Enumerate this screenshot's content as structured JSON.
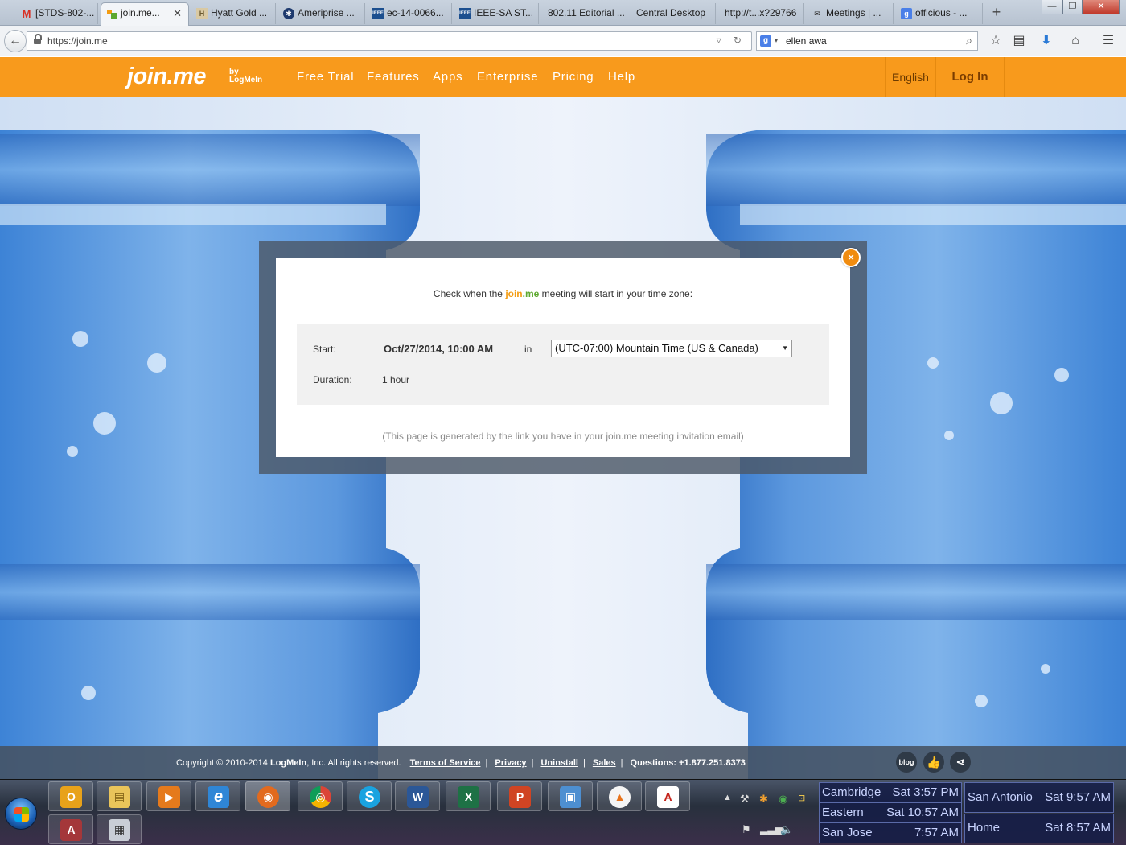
{
  "browser": {
    "tabs": [
      {
        "label": "[STDS-802-...",
        "icon": "gmail-icon"
      },
      {
        "label": "join.me...",
        "icon": "joinme-icon",
        "active": true
      },
      {
        "label": "Hyatt Gold ...",
        "icon": "page-icon"
      },
      {
        "label": "Ameriprise ...",
        "icon": "ameriprise-icon"
      },
      {
        "label": "ec-14-0066...",
        "icon": "ieee-icon"
      },
      {
        "label": "IEEE-SA ST...",
        "icon": "ieee-icon"
      },
      {
        "label": "802.11 Editorial ...",
        "icon": "blank-icon"
      },
      {
        "label": "Central Desktop",
        "icon": "blank-icon"
      },
      {
        "label": "http://t...x?29766",
        "icon": "blank-icon"
      },
      {
        "label": "Meetings | ...",
        "icon": "meetings-icon"
      },
      {
        "label": "officious - ...",
        "icon": "google-icon"
      }
    ],
    "url": "https://join.me",
    "search_engine_icon": "google-icon",
    "search_text": "ellen awa"
  },
  "site": {
    "logo_text": "join.me",
    "logo_by": "by",
    "logo_brand": "LogMeIn",
    "nav": [
      "Free Trial",
      "Features",
      "Apps",
      "Enterprise",
      "Pricing",
      "Help"
    ],
    "language": "English",
    "login": "Log In"
  },
  "modal": {
    "prompt_before": "Check when the ",
    "prompt_brand_join": "join",
    "prompt_brand_me": ".me",
    "prompt_after": " meeting will start in your time zone:",
    "start_label": "Start:",
    "start_value": "Oct/27/2014, 10:00 AM",
    "in_word": "in",
    "timezone": "(UTC-07:00) Mountain Time (US & Canada)",
    "duration_label": "Duration:",
    "duration_value": "1 hour",
    "footnote": "(This page is generated by the link you have in your join.me meeting invitation email)",
    "close_symbol": "×"
  },
  "footer": {
    "copyright_prefix": "Copyright © 2010-2014 ",
    "company": "LogMeIn",
    "copyright_suffix": ", Inc. All rights reserved.",
    "links": [
      "Terms of Service",
      "Privacy",
      "Uninstall",
      "Sales"
    ],
    "questions": "Questions: +1.877.251.8373",
    "blog_label": "blog"
  },
  "taskbar": {
    "pinned": [
      {
        "name": "outlook",
        "glyph": "O"
      },
      {
        "name": "explorer",
        "glyph": "▤"
      },
      {
        "name": "media-player",
        "glyph": "▶"
      },
      {
        "name": "internet-explorer",
        "glyph": "e"
      },
      {
        "name": "firefox",
        "glyph": "◉"
      },
      {
        "name": "chrome",
        "glyph": "◎"
      },
      {
        "name": "skype",
        "glyph": "S"
      },
      {
        "name": "word",
        "glyph": "W"
      },
      {
        "name": "excel",
        "glyph": "X"
      },
      {
        "name": "powerpoint",
        "glyph": "P"
      },
      {
        "name": "remote-desktop",
        "glyph": "▣"
      },
      {
        "name": "vlc",
        "glyph": "▲"
      },
      {
        "name": "acrobat",
        "glyph": "A"
      },
      {
        "name": "access",
        "glyph": "A"
      },
      {
        "name": "calculator",
        "glyph": "▦"
      }
    ],
    "clocks": [
      {
        "city": "Cambridge",
        "time": "Sat 3:57 PM"
      },
      {
        "city": "Eastern",
        "time": "Sat 10:57 AM"
      },
      {
        "city": "San Jose",
        "time": "7:57 AM"
      },
      {
        "city": "San Antonio",
        "time": "Sat 9:57 AM"
      },
      {
        "city": "Home",
        "time": "Sat 8:57 AM"
      }
    ]
  },
  "colors": {
    "brand_orange": "#f89a1c",
    "brand_green": "#5da82f",
    "overlay": "#4c5868"
  }
}
